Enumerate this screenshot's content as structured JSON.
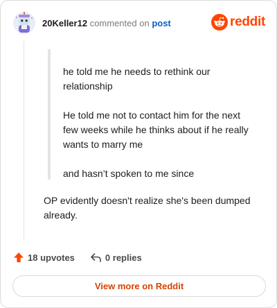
{
  "header": {
    "username": "20Keller12",
    "commented_text": "commented on",
    "post_link": "post",
    "brand": "reddit"
  },
  "quote": {
    "paragraphs": [
      "he told me he needs to rethink our relationship",
      "He told me not to contact him for the next few weeks while he thinks about if he really wants to marry me",
      "and hasn’t spoken to me since"
    ]
  },
  "comment": {
    "body": "OP evidently doesn't realize she's been dumped already."
  },
  "actions": {
    "upvotes": "18 upvotes",
    "replies": "0 replies"
  },
  "footer": {
    "view_more": "View more on Reddit"
  },
  "colors": {
    "brand": "#ff4500",
    "link": "#0b5fbf",
    "view_more": "#d94200"
  },
  "icons": {
    "avatar": "snoo-avatar",
    "logo": "reddit-logo-icon",
    "upvote": "upvote-arrow-icon",
    "reply": "reply-arrow-icon"
  }
}
